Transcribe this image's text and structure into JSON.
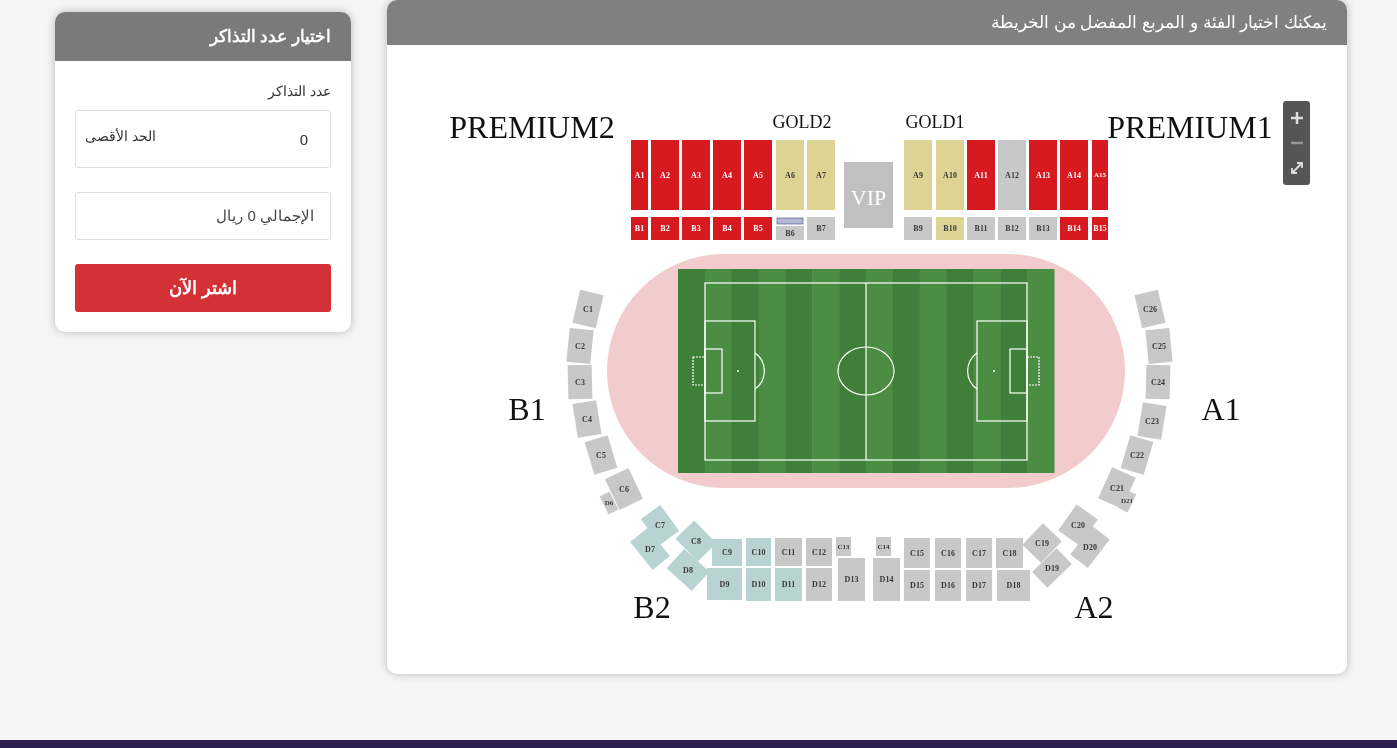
{
  "ticket_panel": {
    "title": "اختيار عدد التذاكر",
    "quantity_label": "عدد التذاكر",
    "quantity": {
      "value": "0",
      "max_label": "الحد الأقصى"
    },
    "total": {
      "value": "الإجمالي 0 ريال"
    },
    "buy_button": "اشتر الآن"
  },
  "map_panel": {
    "title": "يمكنك اختيار الفئة و المربع المفضل من الخريطة",
    "zone_labels": [
      "PREMIUM2",
      "GOLD2",
      "GOLD1",
      "PREMIUM1",
      "B1",
      "A1",
      "B2",
      "A2"
    ],
    "vip_label": "VIP",
    "sections": [
      {
        "label": "A1",
        "color": "#d71920"
      },
      {
        "label": "A2",
        "color": "#d71920"
      },
      {
        "label": "A3",
        "color": "#d71920"
      },
      {
        "label": "A4",
        "color": "#d71920"
      },
      {
        "label": "A5",
        "color": "#d71920"
      },
      {
        "label": "A6",
        "color": "#ddd493"
      },
      {
        "label": "A7",
        "color": "#ddd493"
      },
      {
        "label": "A9",
        "color": "#ddd493"
      },
      {
        "label": "A10",
        "color": "#ddd493"
      },
      {
        "label": "A11",
        "color": "#d71920"
      },
      {
        "label": "A12",
        "color": "#c8c8c8"
      },
      {
        "label": "A13",
        "color": "#d71920"
      },
      {
        "label": "A14",
        "color": "#d71920"
      },
      {
        "label": "A15",
        "color": "#d71920"
      },
      {
        "label": "B1",
        "color": "#d71920"
      },
      {
        "label": "B2",
        "color": "#d71920"
      },
      {
        "label": "B3",
        "color": "#d71920"
      },
      {
        "label": "B4",
        "color": "#d71920"
      },
      {
        "label": "B5",
        "color": "#d71920"
      },
      {
        "label": "B6",
        "color": "#c8c8c8"
      },
      {
        "label": "B7",
        "color": "#c8c8c8"
      },
      {
        "label": "B9",
        "color": "#c8c8c8"
      },
      {
        "label": "B10",
        "color": "#ddd493"
      },
      {
        "label": "B11",
        "color": "#c8c8c8"
      },
      {
        "label": "B12",
        "color": "#c8c8c8"
      },
      {
        "label": "B13",
        "color": "#c8c8c8"
      },
      {
        "label": "B14",
        "color": "#d71920"
      },
      {
        "label": "B15",
        "color": "#d71920"
      },
      {
        "label": "C1",
        "color": "#c8c8c8"
      },
      {
        "label": "C2",
        "color": "#c8c8c8"
      },
      {
        "label": "C3",
        "color": "#c8c8c8"
      },
      {
        "label": "C4",
        "color": "#c8c8c8"
      },
      {
        "label": "C5",
        "color": "#c8c8c8"
      },
      {
        "label": "C6",
        "color": "#c8c8c8"
      },
      {
        "label": "D6",
        "color": "#c8c8c8"
      },
      {
        "label": "C7",
        "color": "#b7d4d2"
      },
      {
        "label": "D7",
        "color": "#b7d4d2"
      },
      {
        "label": "C8",
        "color": "#b7d4d2"
      },
      {
        "label": "D8",
        "color": "#b7d4d2"
      },
      {
        "label": "C9",
        "color": "#b7d4d2"
      },
      {
        "label": "D9",
        "color": "#b7d4d2"
      },
      {
        "label": "C10",
        "color": "#b7d4d2"
      },
      {
        "label": "D10",
        "color": "#b7d4d2"
      },
      {
        "label": "C11",
        "color": "#c8c8c8"
      },
      {
        "label": "D11",
        "color": "#b7d4d2"
      },
      {
        "label": "C12",
        "color": "#c8c8c8"
      },
      {
        "label": "D12",
        "color": "#c8c8c8"
      },
      {
        "label": "C13",
        "color": "#c8c8c8"
      },
      {
        "label": "D13",
        "color": "#c8c8c8"
      },
      {
        "label": "C14",
        "color": "#c8c8c8"
      },
      {
        "label": "D14",
        "color": "#c8c8c8"
      },
      {
        "label": "C15",
        "color": "#c8c8c8"
      },
      {
        "label": "D15",
        "color": "#c8c8c8"
      },
      {
        "label": "C16",
        "color": "#c8c8c8"
      },
      {
        "label": "D16",
        "color": "#c8c8c8"
      },
      {
        "label": "C17",
        "color": "#c8c8c8"
      },
      {
        "label": "D17",
        "color": "#c8c8c8"
      },
      {
        "label": "C18",
        "color": "#c8c8c8"
      },
      {
        "label": "D18",
        "color": "#c8c8c8"
      },
      {
        "label": "C19",
        "color": "#c8c8c8"
      },
      {
        "label": "D19",
        "color": "#c8c8c8"
      },
      {
        "label": "C20",
        "color": "#c8c8c8"
      },
      {
        "label": "D20",
        "color": "#c8c8c8"
      },
      {
        "label": "C21",
        "color": "#c8c8c8"
      },
      {
        "label": "D21",
        "color": "#c8c8c8"
      },
      {
        "label": "C22",
        "color": "#c8c8c8"
      },
      {
        "label": "C23",
        "color": "#c8c8c8"
      },
      {
        "label": "C24",
        "color": "#c8c8c8"
      },
      {
        "label": "C25",
        "color": "#c8c8c8"
      },
      {
        "label": "C26",
        "color": "#c8c8c8"
      }
    ]
  }
}
